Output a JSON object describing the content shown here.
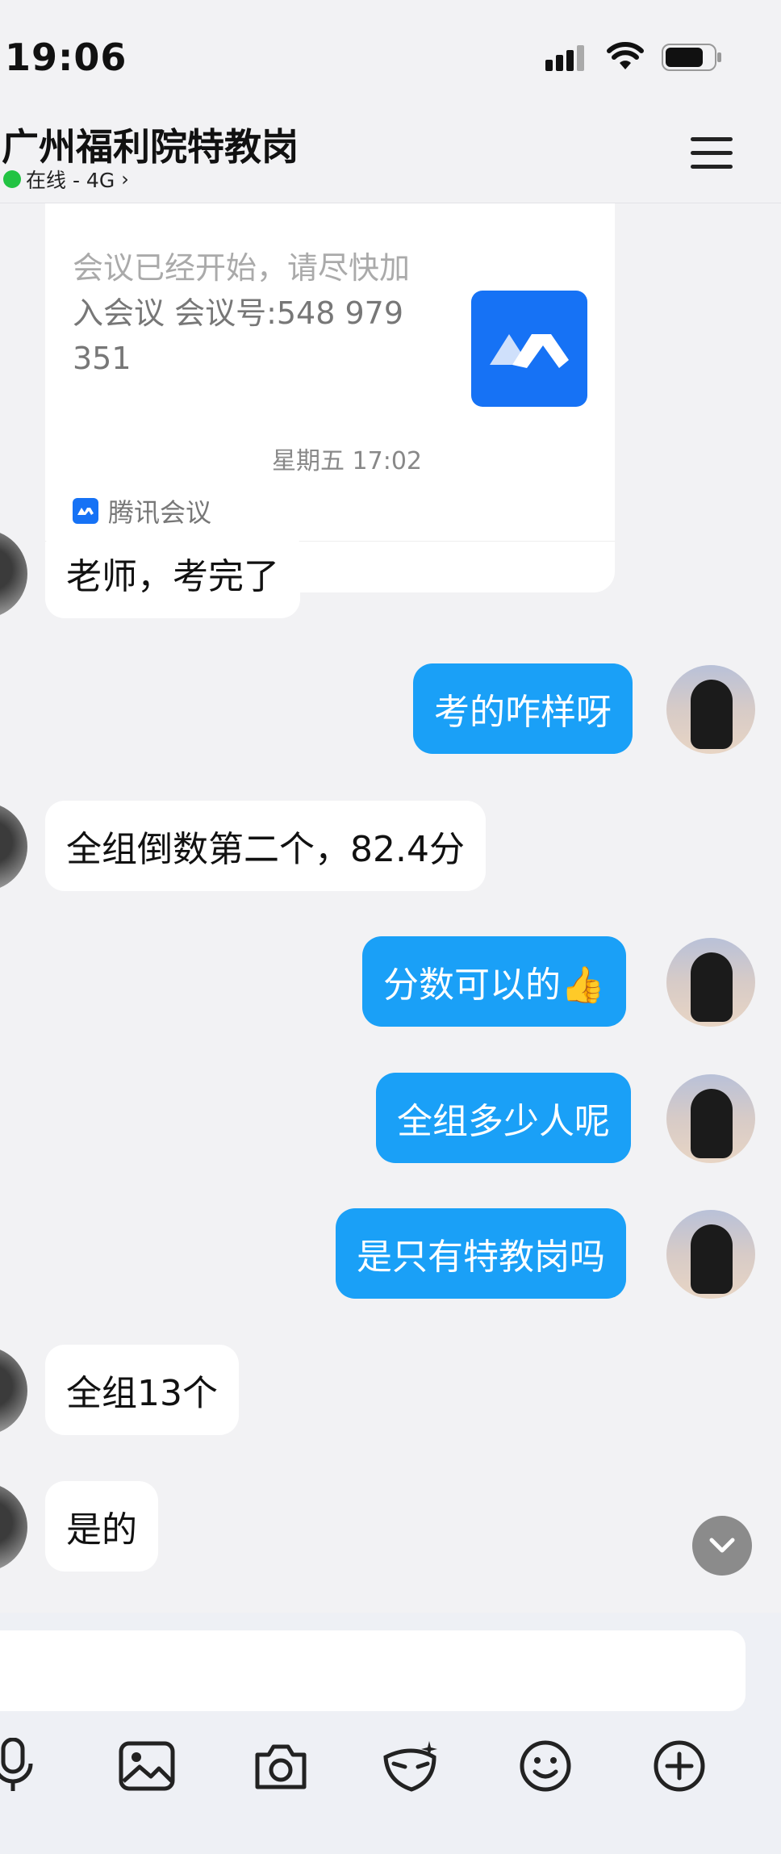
{
  "status_bar": {
    "time": "19:06"
  },
  "header": {
    "title": "广州福利院特教岗",
    "status": "在线 - 4G",
    "status_chevron": "›",
    "status_color": "#23c343"
  },
  "meeting_card": {
    "text_partial": "会议已经开始，请尽快加",
    "text": "入会议 会议号:548 979 351",
    "app_name": "腾讯会议",
    "brand_color": "#1672f5"
  },
  "timestamp": "星期五 17:02",
  "messages": [
    {
      "side": "in",
      "text": "老师，考完了"
    },
    {
      "side": "out",
      "text": "考的咋样呀"
    },
    {
      "side": "in",
      "text": "全组倒数第二个，82.4分"
    },
    {
      "side": "out",
      "text": "分数可以的👍"
    },
    {
      "side": "out",
      "text": "全组多少人呢"
    },
    {
      "side": "out",
      "text": "是只有特教岗吗"
    },
    {
      "side": "in",
      "text": "全组13个"
    },
    {
      "side": "in",
      "text": "是的"
    }
  ],
  "colors": {
    "outgoing_bubble": "#1aa0f7",
    "incoming_bubble": "#ffffff",
    "background": "#f2f2f4"
  },
  "composer": {
    "input_value": "",
    "tools": [
      "microphone-icon",
      "image-icon",
      "camera-icon",
      "face-mask-icon",
      "emoji-icon",
      "plus-icon"
    ]
  }
}
